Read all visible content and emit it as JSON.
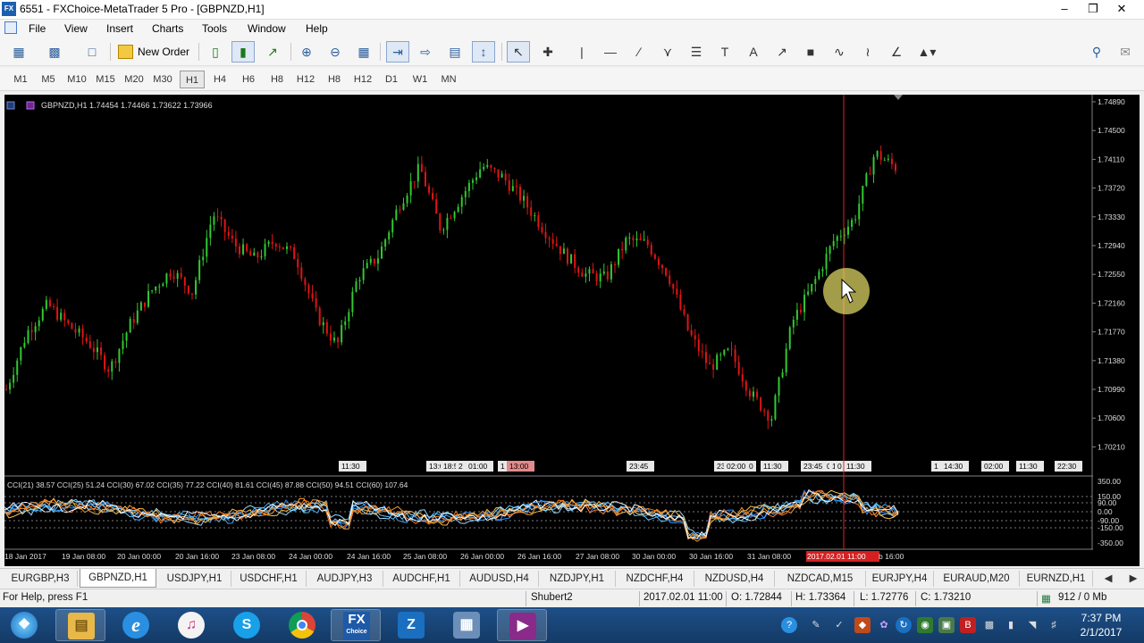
{
  "window": {
    "title": "6551 - FXChoice-MetaTrader 5 Pro - [GBPNZD,H1]",
    "app_icon": "FX",
    "controls": [
      "minimize-icon",
      "restore-icon",
      "close-icon"
    ]
  },
  "menu": {
    "items": [
      "File",
      "View",
      "Insert",
      "Charts",
      "Tools",
      "Window",
      "Help"
    ]
  },
  "toolbar": {
    "new_order_label": "New Order"
  },
  "timeframes": [
    "M1",
    "M5",
    "M10",
    "M15",
    "M20",
    "M30",
    "H1",
    "H4",
    "H6",
    "H8",
    "H12",
    "D1",
    "W1",
    "MN"
  ],
  "active_timeframe": "H1",
  "chart": {
    "symbol_info": "GBPNZD,H1  1.74454 1.74466 1.73622 1.73966",
    "price_labels": [
      "1.74890",
      "1.74500",
      "1.74110",
      "1.73720",
      "1.73330",
      "1.72940",
      "1.72550",
      "1.72160",
      "1.71770",
      "1.71380",
      "1.70990",
      "1.70600",
      "1.70210"
    ],
    "session_labels": [
      "11:30",
      "13:0",
      "18:5",
      "2",
      "01:00",
      "1",
      "13:00",
      "23:45",
      "23",
      "02:00",
      "0",
      "11:30",
      "23:45",
      "0",
      "1",
      "0",
      "11:30",
      "1",
      "14:30",
      "02:00",
      "11:30",
      "22:30"
    ],
    "indicator_header": "CCI(21) 38.57 CCI(25) 51.24 CCI(30) 67.02 CCI(35) 77.22 CCI(40) 81.61 CCI(45) 87.88 CCI(50) 94.51 CCI(60) 107.64",
    "indicator_levels": [
      "350.00",
      "150.00",
      "90.00",
      "0.00",
      "-90.00",
      "-150.00",
      "-350.00"
    ],
    "date_labels": [
      "18 Jan 2017",
      "19 Jan 08:00",
      "20 Jan 00:00",
      "20 Jan 16:00",
      "23 Jan 08:00",
      "24 Jan 00:00",
      "24 Jan 16:00",
      "25 Jan 08:00",
      "26 Jan 00:00",
      "26 Jan 16:00",
      "27 Jan 08:00",
      "30 Jan 00:00",
      "30 Jan 16:00",
      "31 Jan 08:00",
      "2017.02.01 11:00",
      "b 16:00"
    ],
    "colors": {
      "bull": "#32c832",
      "bear": "#e01414",
      "crosshair": "#e62020",
      "background": "#000000"
    }
  },
  "chart_data": {
    "type": "candlestick",
    "series": [
      {
        "name": "GBPNZD,H1",
        "close": [
          1.7099,
          1.7176,
          1.7214,
          1.7186,
          1.7162,
          1.7126,
          1.7188,
          1.7232,
          1.7261,
          1.7231,
          1.7337,
          1.7296,
          1.7276,
          1.7301,
          1.7279,
          1.72,
          1.7158,
          1.7251,
          1.728,
          1.735,
          1.74,
          1.7317,
          1.736,
          1.7402,
          1.7387,
          1.7355,
          1.7316,
          1.7282,
          1.7255,
          1.725,
          1.7302,
          1.7296,
          1.7255,
          1.7176,
          1.7129,
          1.7151,
          1.7093,
          1.706,
          1.719,
          1.724,
          1.73,
          1.733,
          1.742,
          1.74
        ]
      }
    ],
    "ylim": [
      1.6995,
      1.7508
    ]
  },
  "tabs": [
    "EURGBP,H3",
    "GBPNZD,H1",
    "USDJPY,H1",
    "USDCHF,H1",
    "AUDJPY,H3",
    "AUDCHF,H1",
    "AUDUSD,H4",
    "NZDJPY,H1",
    "NZDCHF,H4",
    "NZDUSD,H4",
    "NZDCAD,M15",
    "EURJPY,H4",
    "EURAUD,M20",
    "EURNZD,H1"
  ],
  "active_tab": "GBPNZD,H1",
  "status": {
    "help": "For Help, press F1",
    "profile": "Shubert2",
    "datetime": "2017.02.01 11:00",
    "open": "O: 1.72844",
    "high": "H: 1.73364",
    "low": "L: 1.72776",
    "close": "C: 1.73210",
    "traffic": "912 / 0 Mb"
  },
  "taskbar": {
    "apps": [
      "Start",
      "File Explorer",
      "Internet Explorer",
      "iTunes",
      "Skype",
      "Chrome",
      "FX Choice",
      "Zoom",
      "Network",
      "Video"
    ],
    "fx_label": "FX",
    "fx_sub": "Choice",
    "time": "7:37 PM",
    "date": "2/1/2017"
  }
}
